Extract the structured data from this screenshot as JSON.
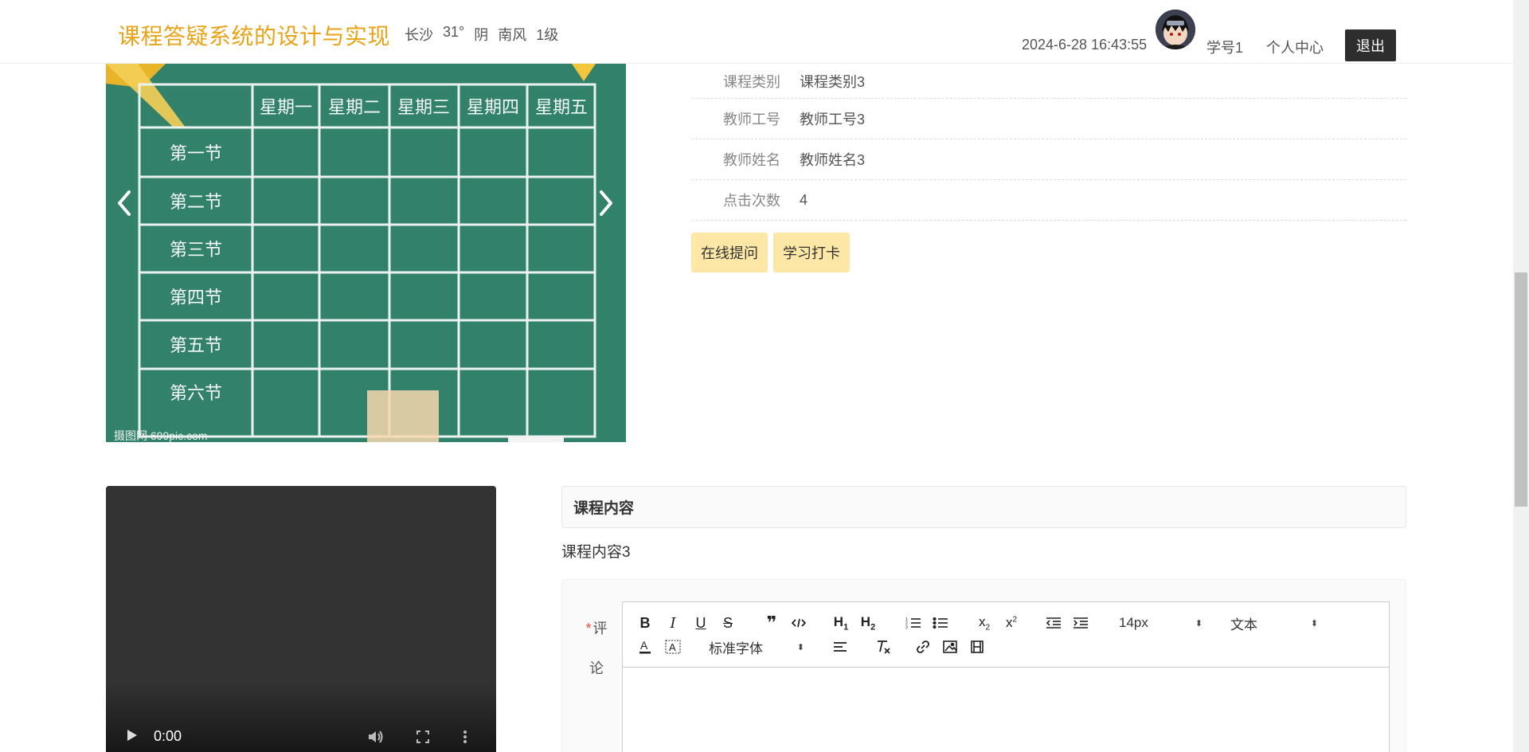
{
  "header": {
    "title": "课程答疑系统的设计与实现",
    "weather": {
      "city": "长沙",
      "temperature": "31°",
      "condition": "阴",
      "wind": "南风",
      "level": "1级"
    },
    "datetime": "2024-6-28 16:43:55",
    "user": "学号1",
    "personal_center": "个人中心",
    "logout": "退出"
  },
  "carousel": {
    "headers": [
      "星期一",
      "星期二",
      "星期三",
      "星期四",
      "星期五"
    ],
    "rows": [
      "第一节",
      "第二节",
      "第三节",
      "第四节",
      "第五节",
      "第六节"
    ],
    "watermark": "摄图网 699pic.com"
  },
  "info": {
    "rows": [
      {
        "label": "课程类别",
        "value": "课程类别3"
      },
      {
        "label": "教师工号",
        "value": "教师工号3"
      },
      {
        "label": "教师姓名",
        "value": "教师姓名3"
      },
      {
        "label": "点击次数",
        "value": "4"
      }
    ],
    "buttons": {
      "ask": "在线提问",
      "checkin": "学习打卡"
    }
  },
  "video": {
    "time": "0:00"
  },
  "content": {
    "heading": "课程内容",
    "text": "课程内容3"
  },
  "comment": {
    "label_line1": "评",
    "label_line2": "论",
    "required_mark": "*",
    "font_size": "14px",
    "paragraph": "文本",
    "font_family": "标准字体"
  },
  "colors": {
    "title": "#e8a317",
    "button": "#fde7a6",
    "logout_bg": "#2e2e2e"
  }
}
